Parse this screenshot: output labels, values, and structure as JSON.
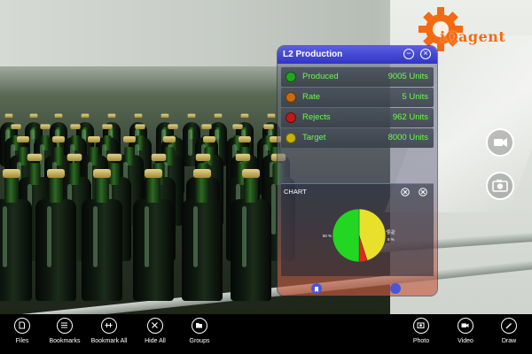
{
  "brand": {
    "logo_text": "iQagent",
    "accent": "#f36a12"
  },
  "panel": {
    "title": "L2 Production",
    "minimize_icon": "minus-circle-icon",
    "close_icon": "close-circle-icon",
    "rows": [
      {
        "label": "Produced",
        "value": "9005 Units",
        "color": "#1fa81f"
      },
      {
        "label": "Rate",
        "value": "5 Units",
        "color": "#c86a10"
      },
      {
        "label": "Rejects",
        "value": "962 Units",
        "color": "#c01a1a"
      },
      {
        "label": "Target",
        "value": "8000 Units",
        "color": "#c8b20a"
      }
    ],
    "chart_title": "CHART"
  },
  "chart_data": {
    "type": "pie",
    "slices": [
      {
        "label": "45 %",
        "value": 45,
        "color": "#e8e02a"
      },
      {
        "label": "0 %",
        "value": 0,
        "color": "#2a6ef0"
      },
      {
        "label": "5 %",
        "value": 5,
        "color": "#e02a1a"
      },
      {
        "label": "50 %",
        "value": 50,
        "color": "#22d622"
      }
    ]
  },
  "appbar": {
    "left": [
      {
        "label": "Files",
        "icon": "file-icon"
      },
      {
        "label": "Bookmarks",
        "icon": "bookmarks-icon"
      },
      {
        "label": "Bookmark All",
        "icon": "bookmark-all-icon"
      },
      {
        "label": "Hide All",
        "icon": "hide-all-icon"
      },
      {
        "label": "Groups",
        "icon": "groups-icon"
      }
    ],
    "right": [
      {
        "label": "Photo",
        "icon": "photo-icon"
      },
      {
        "label": "Video",
        "icon": "video-icon"
      },
      {
        "label": "Draw",
        "icon": "draw-icon"
      }
    ]
  },
  "camera_buttons": [
    {
      "icon": "video-camera-icon"
    },
    {
      "icon": "photo-camera-icon"
    }
  ]
}
